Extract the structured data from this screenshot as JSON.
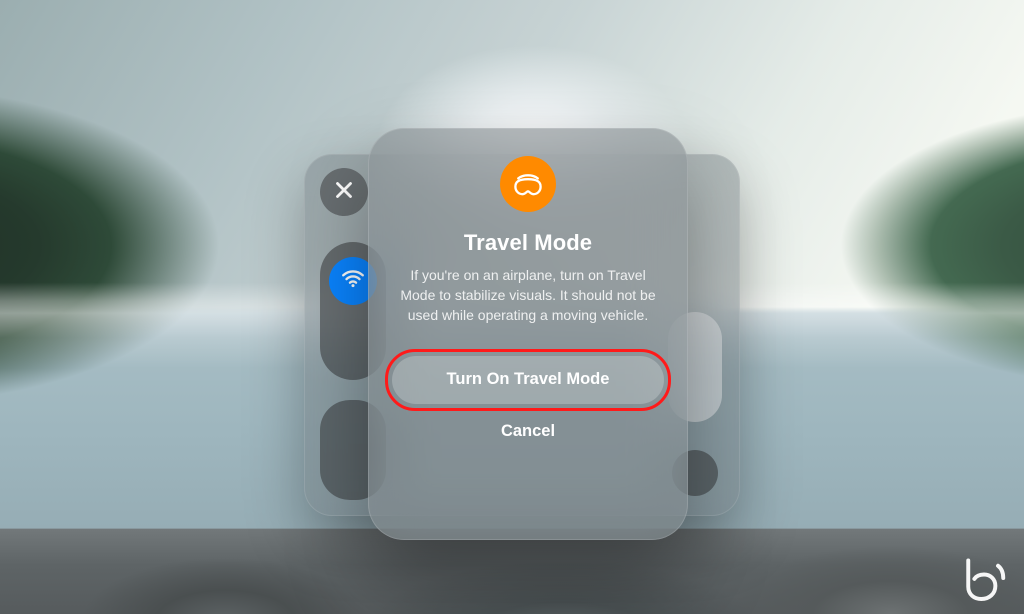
{
  "colors": {
    "accent_blue": "#0a84ff",
    "accent_orange": "#ff8a00",
    "highlight_red": "#ff1a1a"
  },
  "control_center": {
    "close_icon": "close-icon",
    "wifi_icon": "wifi-icon",
    "travel_icon": "travel-mode-icon",
    "focus_icon": "moon-icon",
    "search_icon": "search-icon"
  },
  "modal": {
    "icon": "travel-mode-icon",
    "title": "Travel Mode",
    "body": "If you're on an airplane, turn on Travel Mode to stabilize visuals. It should not be used while operating a moving vehicle.",
    "primary_label": "Turn On Travel Mode",
    "cancel_label": "Cancel"
  },
  "watermark": "beebom-logo"
}
